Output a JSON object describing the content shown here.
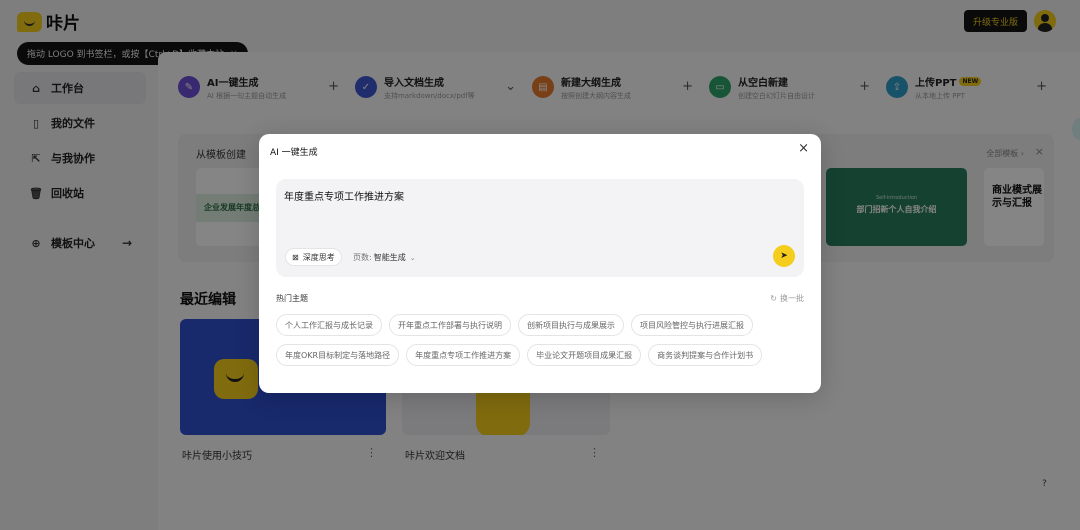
{
  "app": {
    "logo_text": "咔片",
    "upgrade_label": "升级专业版",
    "tip": {
      "text": "拖动 LOGO 到书签栏，或按【Ctrl+D】收藏本站",
      "close": "×"
    }
  },
  "sidebar": {
    "items": [
      {
        "label": "工作台",
        "icon": "home-icon",
        "glyph": "⌂"
      },
      {
        "label": "我的文件",
        "icon": "file-icon",
        "glyph": "▯"
      },
      {
        "label": "与我协作",
        "icon": "share-icon",
        "glyph": "⇱"
      },
      {
        "label": "回收站",
        "icon": "trash-icon",
        "glyph": "🗑"
      },
      {
        "label": "模板中心",
        "icon": "globe-icon",
        "glyph": "⊕",
        "arrow": "→"
      }
    ]
  },
  "actions": [
    {
      "title": "AI一键生成",
      "sub": "AI 根据一句主题自动生成",
      "icon": "ai-pen-icon",
      "glyph": "✎",
      "color": "#6b4fd6",
      "trail": "+"
    },
    {
      "title": "导入文档生成",
      "sub": "支持markdown/docx/pdf等",
      "icon": "import-doc-icon",
      "glyph": "✓",
      "color": "#3f56d2",
      "trail": "⌄"
    },
    {
      "title": "新建大纲生成",
      "sub": "按照创建大纲内容生成",
      "icon": "outline-icon",
      "glyph": "▤",
      "color": "#e8792b",
      "trail": "+"
    },
    {
      "title": "从空白新建",
      "sub": "创建空白幻灯片自由设计",
      "icon": "blank-icon",
      "glyph": "▭",
      "color": "#2ea36a",
      "trail": "+"
    },
    {
      "title": "上传PPT",
      "sub": "从本地上传 PPT",
      "icon": "upload-icon",
      "glyph": "⇪",
      "color": "#2f9ec9",
      "badge": "NEW",
      "trail": "+"
    }
  ],
  "templates": {
    "title": "从模板创建",
    "all_label": "全部模板 ›",
    "close": "×",
    "cards": [
      {
        "text": "企业发展年度总结"
      },
      {
        "pre": "Self-introduction",
        "text": "部门招新个人自我介绍"
      },
      {
        "text": "商业模式展示与汇报"
      }
    ]
  },
  "recent": {
    "title": "最近编辑",
    "items": [
      {
        "label": "咔片使用小技巧",
        "more": "⋮"
      },
      {
        "label": "咔片欢迎文档",
        "more": "⋮"
      }
    ]
  },
  "help_label": "?",
  "modal": {
    "title": "AI 一键生成",
    "close": "×",
    "prompt_value": "年度重点专项工作推进方案",
    "deep_think_label": "深度思考",
    "pages_label": "页数:",
    "pages_value": "智能生成",
    "send_glyph": "➤",
    "hot_title": "热门主题",
    "refresh_label": "换一批",
    "chips": [
      [
        "个人工作汇报与成长记录",
        "开年重点工作部署与执行说明",
        "创新项目执行与成果展示",
        "项目风险管控与执行进展汇报"
      ],
      [
        "年度OKR目标制定与落地路径",
        "年度重点专项工作推进方案",
        "毕业论文开题项目成果汇报",
        "商务谈判提案与合作计划书"
      ]
    ]
  }
}
